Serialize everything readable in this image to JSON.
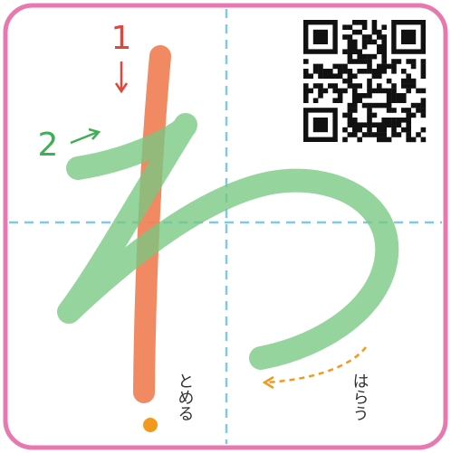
{
  "character": "わ",
  "strokes": [
    {
      "number": "1",
      "color": "#f0835a",
      "number_color": "#e0463a"
    },
    {
      "number": "2",
      "color": "#78c882",
      "number_color": "#3fae55"
    }
  ],
  "labels": {
    "stop": "とめる",
    "sweep": "はらう"
  },
  "colors": {
    "border": "#e879b0",
    "guide": "#7ec9e6",
    "stop_dot": "#f29a1c",
    "sweep_arrow": "#f29a1c"
  },
  "icons": {
    "qr": "qr-code-icon",
    "stroke_1_arrow": "arrow-down-icon",
    "stroke_2_arrow": "arrow-up-right-icon",
    "stop_dot": "dot-icon",
    "sweep_arrow": "dashed-arrow-left-icon"
  }
}
